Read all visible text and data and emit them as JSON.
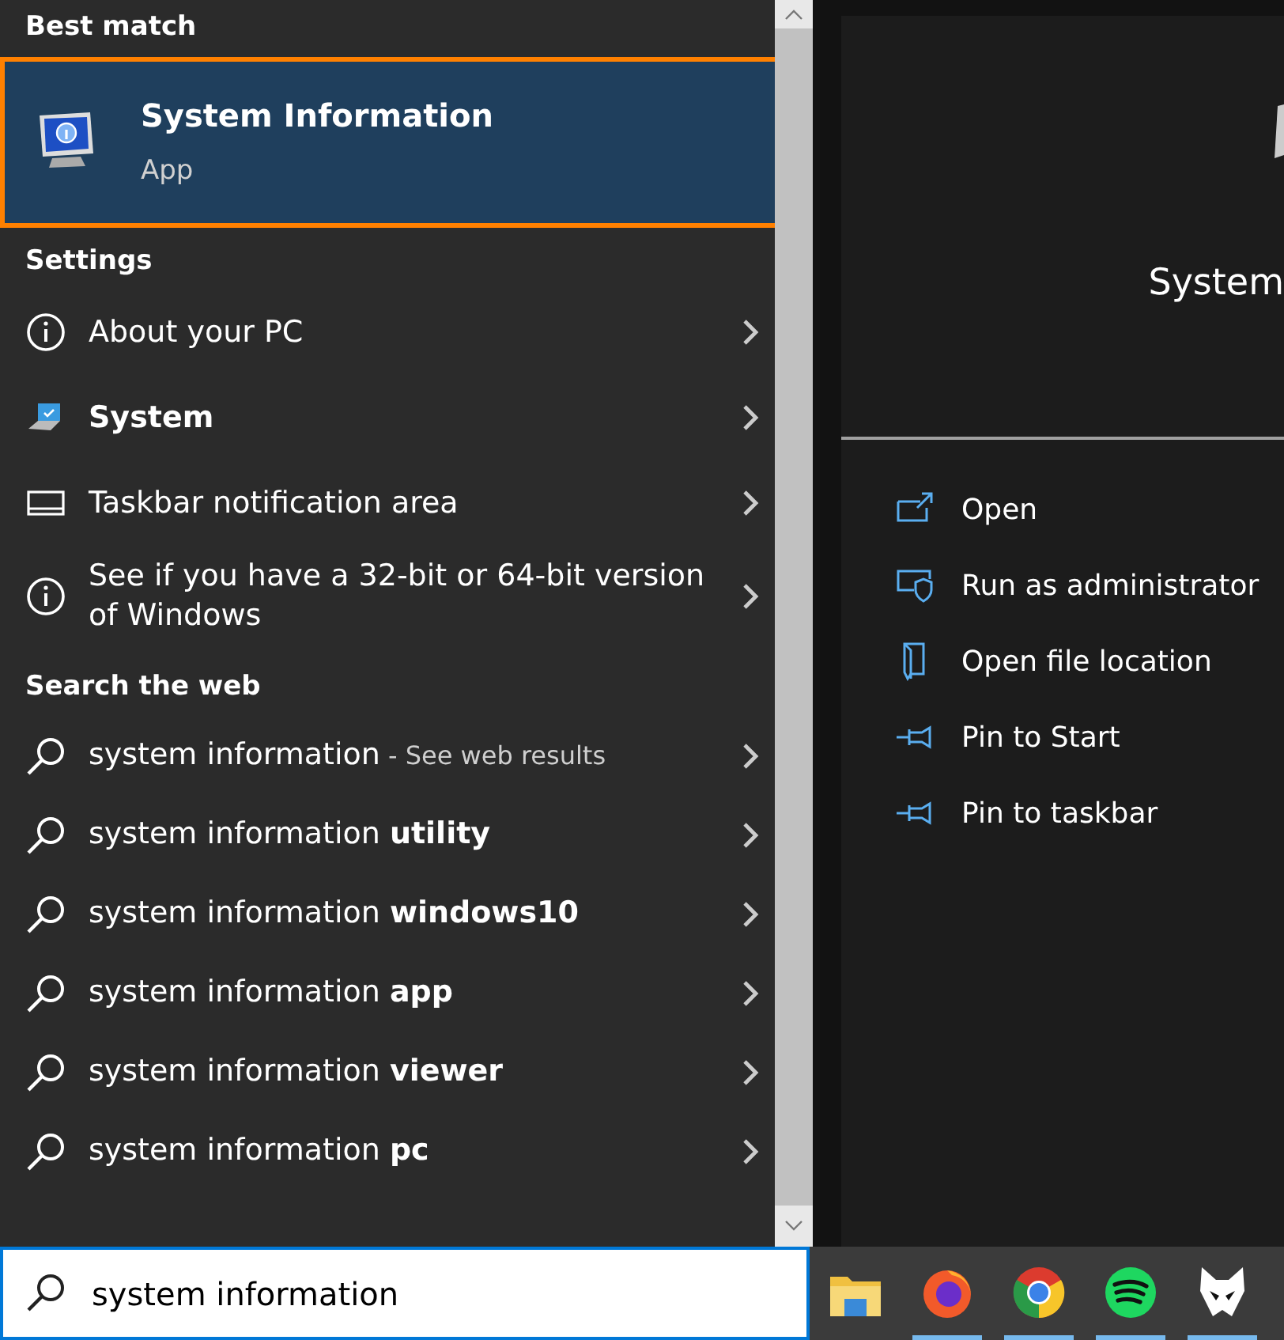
{
  "best_match": {
    "heading": "Best match",
    "item": {
      "title": "System Information",
      "subtitle": "App",
      "selected": true
    }
  },
  "settings": {
    "heading": "Settings",
    "items": [
      {
        "kind": "info",
        "label": "About your PC",
        "emphasized": false
      },
      {
        "kind": "device",
        "label": "System",
        "emphasized": true
      },
      {
        "kind": "taskbar",
        "label": "Taskbar notification area",
        "emphasized": false
      },
      {
        "kind": "info",
        "label": "See if you have a 32-bit or 64-bit version of Windows",
        "emphasized": false
      }
    ]
  },
  "web": {
    "heading": "Search the web",
    "items": [
      {
        "label": "system information",
        "suffix": "- See web results"
      },
      {
        "label": "system information **utility**"
      },
      {
        "label": "system information **windows10**"
      },
      {
        "label": "system information **app**"
      },
      {
        "label": "system information **viewer**"
      },
      {
        "label": "system information **pc**"
      }
    ]
  },
  "preview": {
    "title": "System",
    "actions": [
      {
        "kind": "open",
        "label": "Open"
      },
      {
        "kind": "admin",
        "label": "Run as administrator"
      },
      {
        "kind": "location",
        "label": "Open file location"
      },
      {
        "kind": "pin",
        "label": "Pin to Start"
      },
      {
        "kind": "pin",
        "label": "Pin to taskbar"
      }
    ]
  },
  "search_box": {
    "value": "system information"
  },
  "taskbar": {
    "apps": [
      {
        "kind": "folder",
        "running": false
      },
      {
        "kind": "fox",
        "running": true
      },
      {
        "kind": "wheel",
        "running": true
      },
      {
        "kind": "waves",
        "running": true
      },
      {
        "kind": "cat",
        "running": true
      }
    ]
  }
}
